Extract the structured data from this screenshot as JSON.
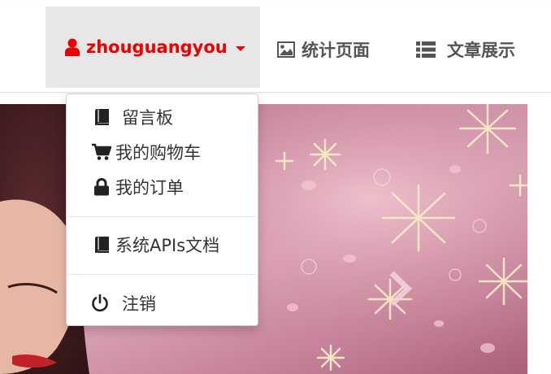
{
  "navbar": {
    "user": {
      "label": "zhouguangyou",
      "icon": "user-icon"
    },
    "stats": {
      "label": "统计页面",
      "icon": "picture-icon"
    },
    "articles": {
      "label": "文章展示",
      "icon": "list-icon"
    }
  },
  "dropdown": {
    "items": [
      {
        "label": "留言板",
        "icon": "book-icon"
      },
      {
        "label": "我的购物车",
        "icon": "shopping-cart-icon"
      },
      {
        "label": "我的订单",
        "icon": "lock-icon"
      },
      {
        "label": "系统APIs文档",
        "icon": "book-icon"
      },
      {
        "label": "注销",
        "icon": "power-icon"
      }
    ]
  },
  "colors": {
    "accent": "#ee0000",
    "nav_text": "#555555",
    "active_bg": "#e7e7e7",
    "menu_text": "#333333"
  }
}
